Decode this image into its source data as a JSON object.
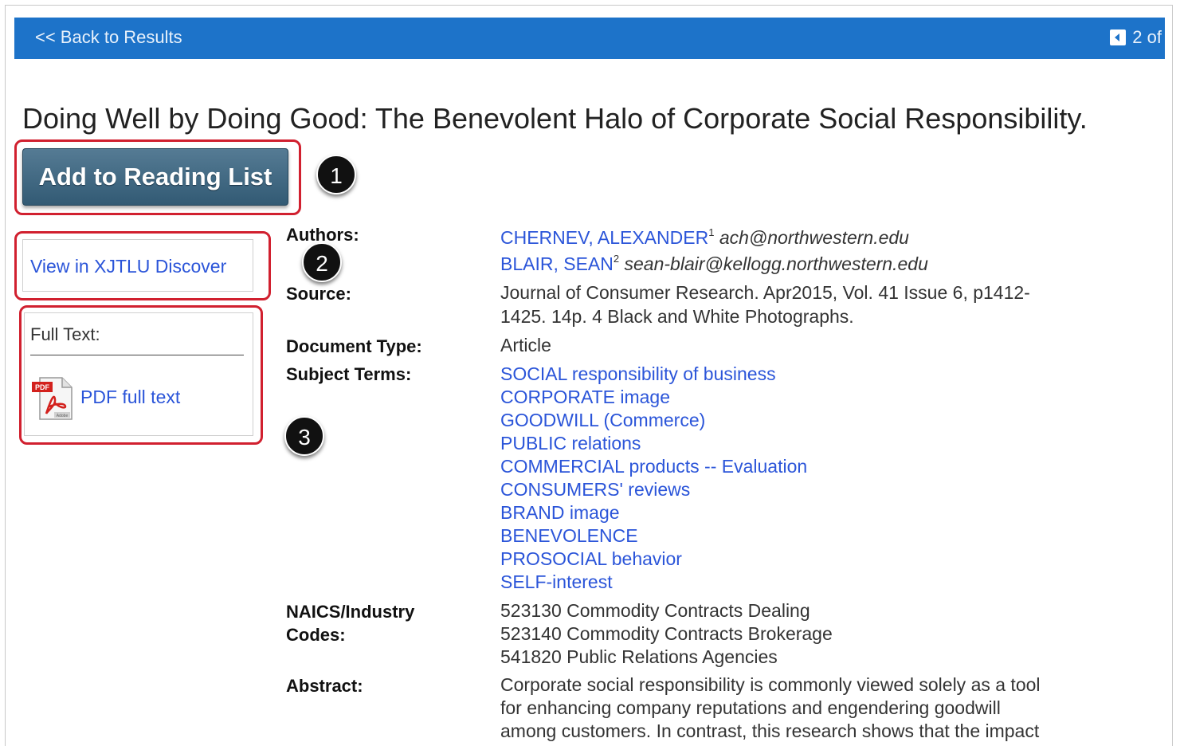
{
  "topbar": {
    "back_label": "<< Back to Results",
    "pager_text": "2 of"
  },
  "article": {
    "title": "Doing Well by Doing Good: The Benevolent Halo of Corporate Social Responsibility."
  },
  "actions": {
    "add_reading_list": "Add to Reading List",
    "view_discover": "View in XJTLU Discover",
    "full_text_label": "Full Text:",
    "pdf_label": "PDF full text"
  },
  "callouts": [
    "1",
    "2",
    "3"
  ],
  "fields": {
    "authors_label": "Authors:",
    "authors": [
      {
        "name": "CHERNEV, ALEXANDER",
        "sup": "1",
        "email": "ach@northwestern.edu"
      },
      {
        "name": "BLAIR, SEAN",
        "sup": "2",
        "email": "sean-blair@kellogg.northwestern.edu"
      }
    ],
    "source_label": "Source:",
    "source_line1": "Journal of Consumer Research. Apr2015, Vol. 41 Issue 6, p1412-",
    "source_line2": "1425. 14p. 4 Black and White Photographs.",
    "doctype_label": "Document Type:",
    "doctype": "Article",
    "subjects_label": "Subject Terms:",
    "subjects": [
      "SOCIAL responsibility of business",
      "CORPORATE image",
      "GOODWILL (Commerce)",
      "PUBLIC relations",
      "COMMERCIAL products -- Evaluation",
      "CONSUMERS' reviews",
      "BRAND image",
      "BENEVOLENCE",
      "PROSOCIAL behavior",
      "SELF-interest"
    ],
    "naics_label_1": "NAICS/Industry",
    "naics_label_2": "Codes:",
    "naics": [
      "523130 Commodity Contracts Dealing",
      "523140 Commodity Contracts Brokerage",
      "541820 Public Relations Agencies"
    ],
    "abstract_label": "Abstract:",
    "abstract_line1": "Corporate social responsibility is commonly viewed solely as a tool",
    "abstract_line2": "for enhancing company reputations and engendering goodwill",
    "abstract_line3": "among customers. In contrast, this research shows that the impact"
  },
  "colors": {
    "topbar": "#1d73c9",
    "link": "#2b55d9",
    "button": "#3c6580",
    "highlight": "#d1202f"
  }
}
